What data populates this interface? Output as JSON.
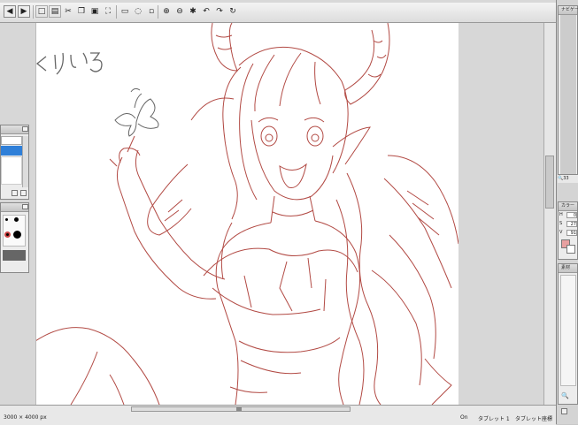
{
  "canvas_doodle_text": "くりいる",
  "status": {
    "canvas_size": "3000 × 4000 px",
    "pen_state": "On",
    "tablet": "タブレット 1",
    "tablet_coords": "タブレット座標"
  },
  "right_panels": {
    "navigator_title": "ナビゲー",
    "color_title": "カラー",
    "color_h_label": "H",
    "color_h_value": "0",
    "color_s_label": "S",
    "color_s_value": "27",
    "color_v_label": "V",
    "color_v_value": "91",
    "material_title": "素材",
    "zoom_value": "33"
  },
  "colors": {
    "line_art": "#b24a44",
    "doodle": "#666666",
    "fg_swatch": "#e8a0a0",
    "layer_selected": "#2f7fd8"
  },
  "toolbar_icons": [
    "back-icon",
    "forward-icon",
    "new-icon",
    "open-icon",
    "cut-icon",
    "copy-icon",
    "paste-icon",
    "fit-icon",
    "rect-select-icon",
    "lasso-icon",
    "move-icon",
    "zoom-in-icon",
    "zoom-out-icon",
    "rotate-icon",
    "undo-icon",
    "redo-icon",
    "refresh-icon"
  ]
}
